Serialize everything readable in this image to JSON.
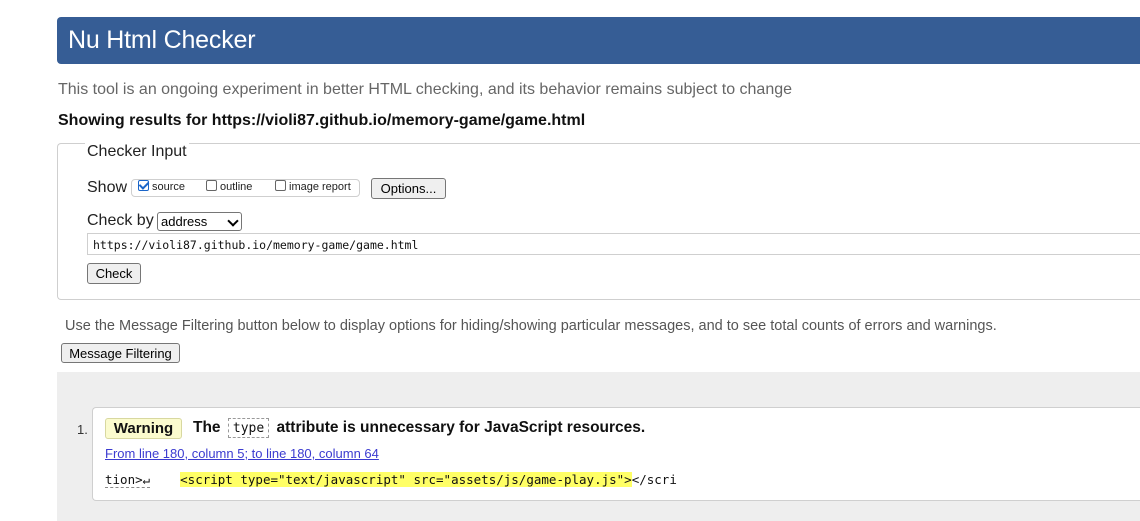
{
  "header": {
    "title": "Nu Html Checker"
  },
  "intro": "This tool is an ongoing experiment in better HTML checking, and its behavior remains subject to change",
  "results_for": "Showing results for https://violi87.github.io/memory-game/game.html",
  "checker": {
    "legend": "Checker Input",
    "show_label": "Show",
    "options": [
      {
        "label": "source",
        "checked": true
      },
      {
        "label": "outline",
        "checked": false
      },
      {
        "label": "image report",
        "checked": false
      }
    ],
    "options_button": "Options...",
    "check_by_label": "Check by",
    "check_by_value": "address",
    "url_value": "https://violi87.github.io/memory-game/game.html",
    "check_button": "Check"
  },
  "filter_help": "Use the Message Filtering button below to display options for hiding/showing particular messages, and to see total counts of errors and warnings.",
  "filter_button": "Message Filtering",
  "messages": [
    {
      "number": "1.",
      "type": "Warning",
      "text_before": "The",
      "code": "type",
      "text_after": "attribute is unnecessary for JavaScript resources.",
      "location": "From line 180, column 5; to line 180, column 64",
      "extract_prefix": "tion>↵",
      "extract_highlight": "<script type=\"text/javascript\" src=\"assets/js/game-play.js\">",
      "extract_suffix": "</scri"
    }
  ]
}
